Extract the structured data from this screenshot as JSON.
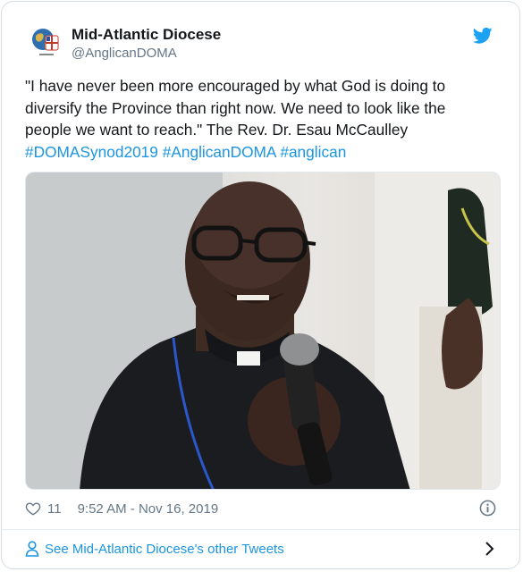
{
  "tweet": {
    "author_name": "Mid-Atlantic Diocese",
    "author_handle": "@AnglicanDOMA",
    "text": "\"I have never been more encouraged by what God is doing to diversify the Province than right now. We need to look like the people we want to reach.\" The Rev. Dr. Esau McCaulley",
    "hashtags": [
      "#DOMASynod2019",
      "#AnglicanDOMA",
      "#anglican"
    ],
    "likes": "11",
    "timestamp": "9:52 AM - Nov 16, 2019",
    "footer_link": "See Mid-Atlantic Diocese's other Tweets"
  },
  "icons": {
    "brand": "twitter-bird-icon",
    "like": "heart-icon",
    "info": "info-icon",
    "profile": "person-icon",
    "more": "chevron-right-icon"
  },
  "colors": {
    "link": "#1b95e0",
    "muted": "#657786",
    "text": "#14171a",
    "border": "#e1e8ed"
  }
}
